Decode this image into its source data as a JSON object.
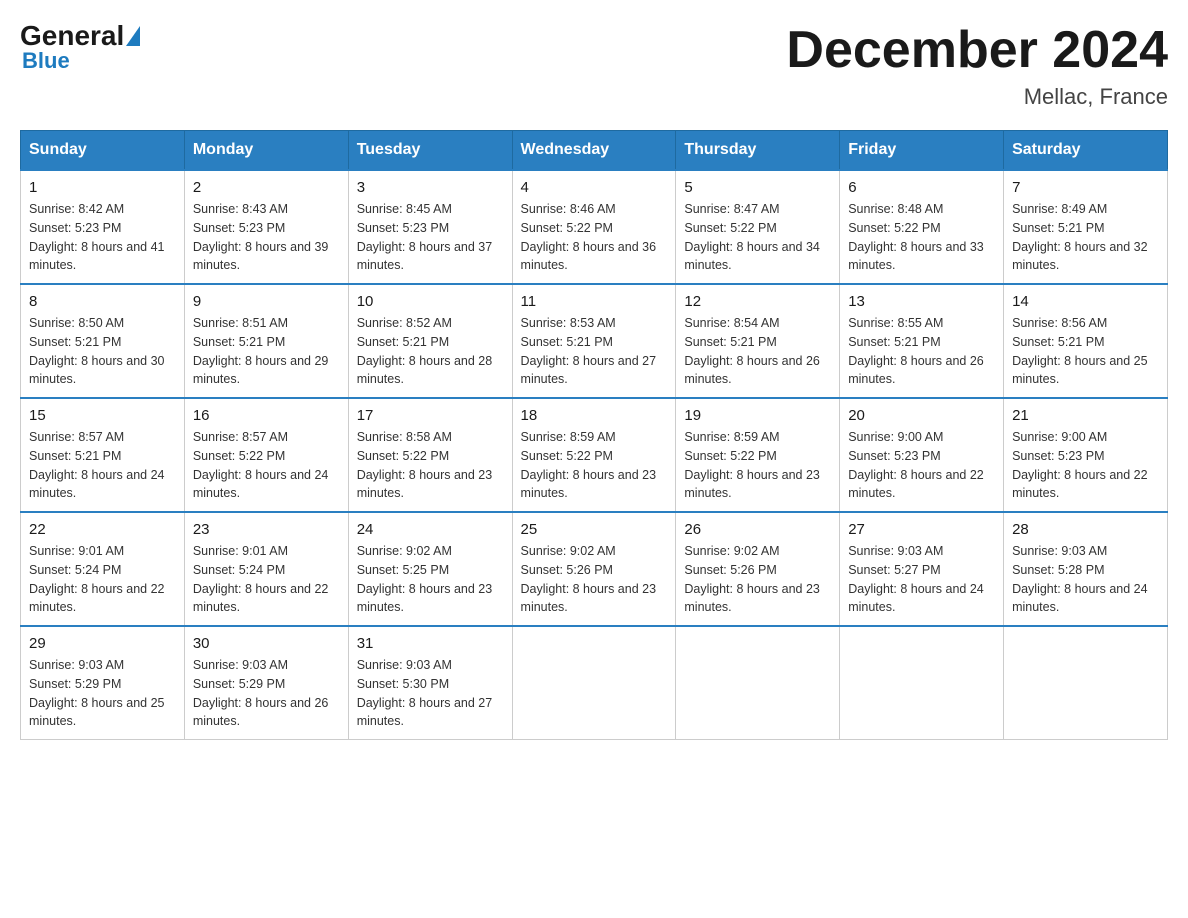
{
  "logo": {
    "general": "General",
    "blue": "Blue"
  },
  "title": "December 2024",
  "subtitle": "Mellac, France",
  "days_of_week": [
    "Sunday",
    "Monday",
    "Tuesday",
    "Wednesday",
    "Thursday",
    "Friday",
    "Saturday"
  ],
  "weeks": [
    [
      {
        "day": "1",
        "sunrise": "8:42 AM",
        "sunset": "5:23 PM",
        "daylight": "8 hours and 41 minutes."
      },
      {
        "day": "2",
        "sunrise": "8:43 AM",
        "sunset": "5:23 PM",
        "daylight": "8 hours and 39 minutes."
      },
      {
        "day": "3",
        "sunrise": "8:45 AM",
        "sunset": "5:23 PM",
        "daylight": "8 hours and 37 minutes."
      },
      {
        "day": "4",
        "sunrise": "8:46 AM",
        "sunset": "5:22 PM",
        "daylight": "8 hours and 36 minutes."
      },
      {
        "day": "5",
        "sunrise": "8:47 AM",
        "sunset": "5:22 PM",
        "daylight": "8 hours and 34 minutes."
      },
      {
        "day": "6",
        "sunrise": "8:48 AM",
        "sunset": "5:22 PM",
        "daylight": "8 hours and 33 minutes."
      },
      {
        "day": "7",
        "sunrise": "8:49 AM",
        "sunset": "5:21 PM",
        "daylight": "8 hours and 32 minutes."
      }
    ],
    [
      {
        "day": "8",
        "sunrise": "8:50 AM",
        "sunset": "5:21 PM",
        "daylight": "8 hours and 30 minutes."
      },
      {
        "day": "9",
        "sunrise": "8:51 AM",
        "sunset": "5:21 PM",
        "daylight": "8 hours and 29 minutes."
      },
      {
        "day": "10",
        "sunrise": "8:52 AM",
        "sunset": "5:21 PM",
        "daylight": "8 hours and 28 minutes."
      },
      {
        "day": "11",
        "sunrise": "8:53 AM",
        "sunset": "5:21 PM",
        "daylight": "8 hours and 27 minutes."
      },
      {
        "day": "12",
        "sunrise": "8:54 AM",
        "sunset": "5:21 PM",
        "daylight": "8 hours and 26 minutes."
      },
      {
        "day": "13",
        "sunrise": "8:55 AM",
        "sunset": "5:21 PM",
        "daylight": "8 hours and 26 minutes."
      },
      {
        "day": "14",
        "sunrise": "8:56 AM",
        "sunset": "5:21 PM",
        "daylight": "8 hours and 25 minutes."
      }
    ],
    [
      {
        "day": "15",
        "sunrise": "8:57 AM",
        "sunset": "5:21 PM",
        "daylight": "8 hours and 24 minutes."
      },
      {
        "day": "16",
        "sunrise": "8:57 AM",
        "sunset": "5:22 PM",
        "daylight": "8 hours and 24 minutes."
      },
      {
        "day": "17",
        "sunrise": "8:58 AM",
        "sunset": "5:22 PM",
        "daylight": "8 hours and 23 minutes."
      },
      {
        "day": "18",
        "sunrise": "8:59 AM",
        "sunset": "5:22 PM",
        "daylight": "8 hours and 23 minutes."
      },
      {
        "day": "19",
        "sunrise": "8:59 AM",
        "sunset": "5:22 PM",
        "daylight": "8 hours and 23 minutes."
      },
      {
        "day": "20",
        "sunrise": "9:00 AM",
        "sunset": "5:23 PM",
        "daylight": "8 hours and 22 minutes."
      },
      {
        "day": "21",
        "sunrise": "9:00 AM",
        "sunset": "5:23 PM",
        "daylight": "8 hours and 22 minutes."
      }
    ],
    [
      {
        "day": "22",
        "sunrise": "9:01 AM",
        "sunset": "5:24 PM",
        "daylight": "8 hours and 22 minutes."
      },
      {
        "day": "23",
        "sunrise": "9:01 AM",
        "sunset": "5:24 PM",
        "daylight": "8 hours and 22 minutes."
      },
      {
        "day": "24",
        "sunrise": "9:02 AM",
        "sunset": "5:25 PM",
        "daylight": "8 hours and 23 minutes."
      },
      {
        "day": "25",
        "sunrise": "9:02 AM",
        "sunset": "5:26 PM",
        "daylight": "8 hours and 23 minutes."
      },
      {
        "day": "26",
        "sunrise": "9:02 AM",
        "sunset": "5:26 PM",
        "daylight": "8 hours and 23 minutes."
      },
      {
        "day": "27",
        "sunrise": "9:03 AM",
        "sunset": "5:27 PM",
        "daylight": "8 hours and 24 minutes."
      },
      {
        "day": "28",
        "sunrise": "9:03 AM",
        "sunset": "5:28 PM",
        "daylight": "8 hours and 24 minutes."
      }
    ],
    [
      {
        "day": "29",
        "sunrise": "9:03 AM",
        "sunset": "5:29 PM",
        "daylight": "8 hours and 25 minutes."
      },
      {
        "day": "30",
        "sunrise": "9:03 AM",
        "sunset": "5:29 PM",
        "daylight": "8 hours and 26 minutes."
      },
      {
        "day": "31",
        "sunrise": "9:03 AM",
        "sunset": "5:30 PM",
        "daylight": "8 hours and 27 minutes."
      },
      null,
      null,
      null,
      null
    ]
  ]
}
